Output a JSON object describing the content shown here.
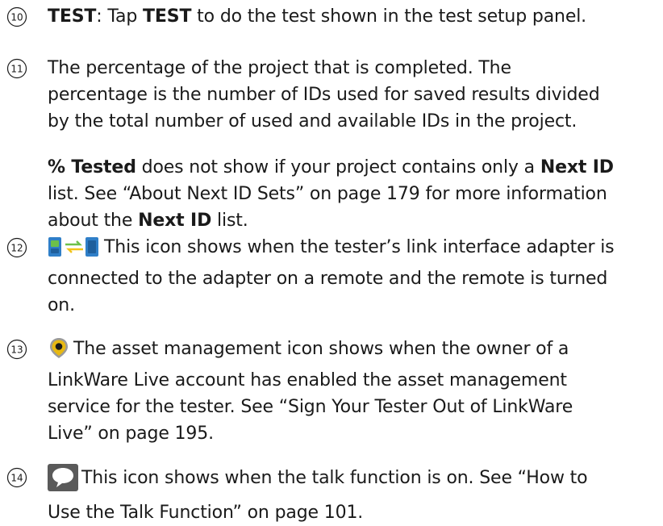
{
  "items": [
    {
      "number": "10",
      "term": "TEST",
      "sep": ": Tap ",
      "term2": "TEST",
      "rest": " to do the test shown in the test setup panel."
    },
    {
      "number": "11",
      "line1": "The percentage of the project that is completed. The",
      "line2": "percentage is the number of IDs used for saved results divided",
      "line3": "by the total number of used and available IDs in the project.",
      "note": {
        "bold1": "% Tested",
        "t1": " does not show if your project contains only a ",
        "bold2": "Next ID",
        "t2": "list. See “About Next ID Sets” on page 179 for more information",
        "t3": "about the ",
        "bold3": "Next ID",
        "t4": " list."
      }
    },
    {
      "number": "12",
      "icon": "link-interface-adapter-icon",
      "line1": "This icon shows when the tester’s link interface adapter is",
      "line2": "connected to the adapter on a remote and the remote is turned",
      "line3": "on."
    },
    {
      "number": "13",
      "icon": "asset-management-icon",
      "line1": "The asset management icon shows when the owner of a",
      "line2": "LinkWare Live account has enabled the asset management",
      "line3": "service for the tester. See “Sign Your Tester Out of LinkWare",
      "line4": "Live” on page 195."
    },
    {
      "number": "14",
      "icon": "talk-function-icon",
      "line1": "This icon shows when the talk function is on. See “How to",
      "line2": "Use the Talk Function” on page 101."
    }
  ],
  "colors": {
    "text": "#1a1a1a",
    "adapter_blue": "#2f7fc8",
    "adapter_green": "#6cc04a",
    "adapter_yellow": "#f2c318",
    "bubble_dark": "#5a5a5a",
    "bubble_light": "#ffffff",
    "pin_yellow": "#e8b912",
    "pin_gray": "#9a9a9a"
  }
}
